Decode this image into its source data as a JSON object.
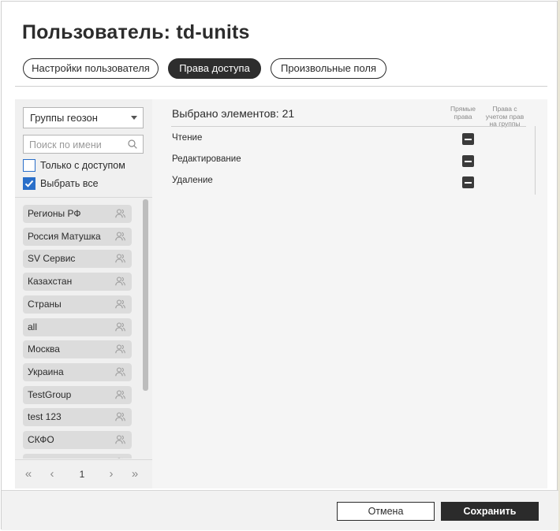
{
  "dialog": {
    "title": "Пользователь: td-units"
  },
  "tabs": [
    {
      "label": "Настройки пользователя",
      "active": false
    },
    {
      "label": "Права доступа",
      "active": true
    },
    {
      "label": "Произвольные поля",
      "active": false
    }
  ],
  "left": {
    "select_value": "Группы геозон",
    "search_placeholder": "Поиск по имени",
    "only_with_access": {
      "label": "Только с доступом",
      "checked": false
    },
    "select_all": {
      "label": "Выбрать все",
      "checked": true
    },
    "items": [
      "Регионы РФ",
      "Россия Матушка",
      "SV Сервис",
      "Казахстан",
      "Страны",
      "all",
      "Москва",
      "Украина",
      "TestGroup",
      "test 123",
      "СКФО",
      ""
    ],
    "pager": {
      "first": "«",
      "prev": "‹",
      "page": "1",
      "next": "›",
      "last": "»"
    }
  },
  "right": {
    "selected_count": "Выбрано элементов: 21",
    "col_direct": "Прямые права",
    "col_with_groups": "Права с учетом прав на группы",
    "permissions": [
      {
        "label": "Чтение"
      },
      {
        "label": "Редактирование"
      },
      {
        "label": "Удаление"
      }
    ]
  },
  "footer": {
    "cancel": "Отмена",
    "save": "Сохранить"
  },
  "colors": {
    "accent": "#2a6fc9",
    "dark": "#2e2e2e",
    "panel_bg": "#f0f0f0"
  }
}
